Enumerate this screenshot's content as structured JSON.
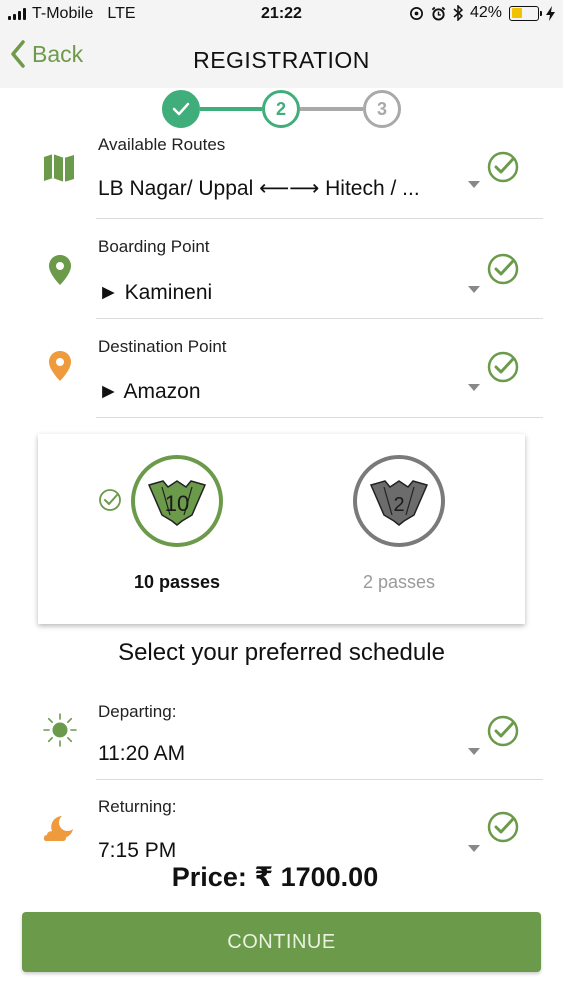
{
  "status_bar": {
    "carrier": "T-Mobile",
    "network": "LTE",
    "time": "21:22",
    "battery": "42%",
    "battery_level": 0.42
  },
  "nav": {
    "back_label": "Back",
    "title": "REGISTRATION"
  },
  "stepper": {
    "steps": [
      "1",
      "2",
      "3"
    ],
    "current": 2,
    "colors": {
      "done": "#3fae7a",
      "active": "#3fae7a",
      "pending": "#a9a9a9"
    }
  },
  "route": {
    "label": "Available Routes",
    "value": "LB Nagar/ Uppal ⟵⟶ Hitech / ..."
  },
  "boarding": {
    "label": "Boarding Point",
    "value": "► Kamineni"
  },
  "destination": {
    "label": "Destination Point",
    "value": "► Amazon"
  },
  "passes": {
    "options": [
      {
        "count": "10",
        "label": "10 passes",
        "selected": true
      },
      {
        "count": "2",
        "label": "2 passes",
        "selected": false
      }
    ]
  },
  "schedule": {
    "title": "Select your preferred schedule",
    "departing": {
      "label": "Departing:",
      "value": "11:20 AM"
    },
    "returning": {
      "label": "Returning:",
      "value": "7:15 PM"
    }
  },
  "price": "Price: ₹ 1700.00",
  "continue_label": "CONTINUE",
  "colors": {
    "accent_green": "#6b9a4a",
    "step_green": "#3fae7a",
    "orange": "#ef9a3c"
  }
}
